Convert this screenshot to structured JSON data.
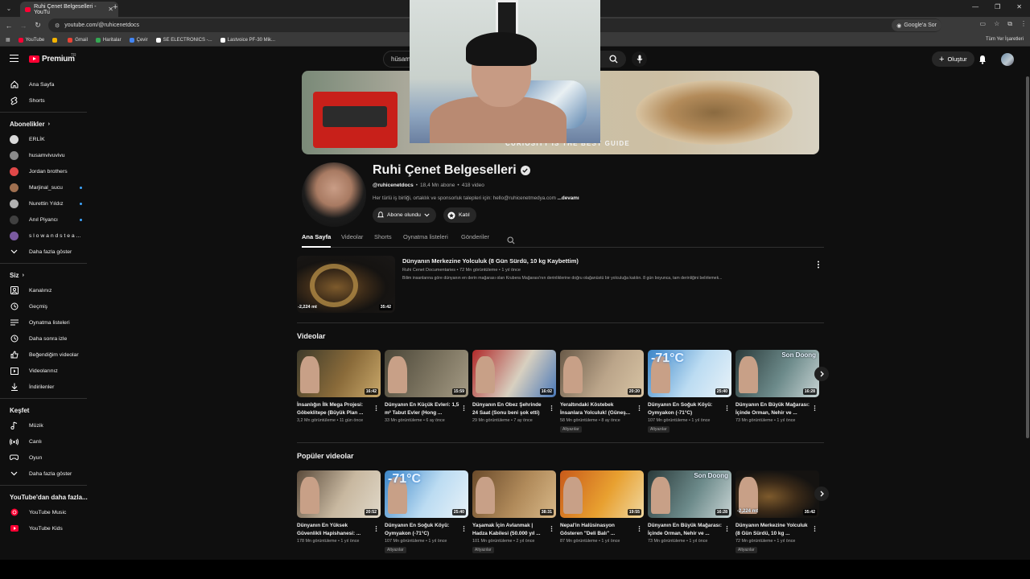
{
  "browser": {
    "tab_title": "Ruhi Çenet Belgeselleri - YouTu",
    "url": "youtube.com/@ruhicenetdocs",
    "google_lens": "Google'a Sor",
    "bookmarks": [
      {
        "label": "YouTube",
        "color": "#ff0033"
      },
      {
        "label": "",
        "color": "#f4b400"
      },
      {
        "label": "Gmail",
        "color": "#ea4335"
      },
      {
        "label": "Haritalar",
        "color": "#34a853"
      },
      {
        "label": "Çevir",
        "color": "#4285f4"
      },
      {
        "label": "SE ELECTRONICS -...",
        "color": "#ffffff"
      },
      {
        "label": "Lastvoice PF-30 Mik...",
        "color": "#ffffff"
      }
    ],
    "all_bookmarks": "Tüm Yer İşaretleri"
  },
  "header": {
    "logo": "Premium",
    "logo_sup": "TR",
    "search_value": "hüsam",
    "create_label": "Oluştur"
  },
  "sidebar": {
    "main": [
      {
        "label": "Ana Sayfa",
        "icon": "home-icon"
      },
      {
        "label": "Shorts",
        "icon": "shorts-icon"
      }
    ],
    "subs_heading": "Abonelikler",
    "subs": [
      {
        "label": "ERLİK",
        "color": "#d9d9d9",
        "dot": false
      },
      {
        "label": "husamvivuvivu",
        "color": "#8a8a8a",
        "dot": false
      },
      {
        "label": "Jordan brothers",
        "color": "#e04848",
        "dot": false
      },
      {
        "label": "Marjinal_sucu",
        "color": "#a07050",
        "dot": true
      },
      {
        "label": "Nurettin Yıldız",
        "color": "#b0b0b0",
        "dot": true
      },
      {
        "label": "Anıl Piyancı",
        "color": "#404040",
        "dot": true
      },
      {
        "label": "s l o w a n d s t e a ...",
        "color": "#7a5aa0",
        "dot": false
      }
    ],
    "subs_more": "Daha fazla göster",
    "you_heading": "Siz",
    "you": [
      {
        "label": "Kanalınız",
        "icon": "channel-icon"
      },
      {
        "label": "Geçmiş",
        "icon": "history-icon"
      },
      {
        "label": "Oynatma listeleri",
        "icon": "playlist-icon"
      },
      {
        "label": "Daha sonra izle",
        "icon": "clock-icon"
      },
      {
        "label": "Beğendiğim videolar",
        "icon": "like-icon"
      },
      {
        "label": "Videolarınız",
        "icon": "video-icon"
      },
      {
        "label": "İndirilenler",
        "icon": "download-icon"
      }
    ],
    "explore_heading": "Keşfet",
    "explore": [
      {
        "label": "Müzik",
        "icon": "music-icon"
      },
      {
        "label": "Canlı",
        "icon": "live-icon"
      },
      {
        "label": "Oyun",
        "icon": "gaming-icon"
      }
    ],
    "explore_more": "Daha fazla göster",
    "more_heading": "YouTube'dan daha fazla...",
    "more": [
      {
        "label": "YouTube Music"
      },
      {
        "label": "YouTube Kids"
      }
    ]
  },
  "channel": {
    "banner_tagline": "CURIOSITY IS THE BEST GUIDE",
    "name": "Ruhi Çenet Belgeselleri",
    "handle": "@ruhicenetdocs",
    "subscribers": "18,4 Mn abone",
    "video_count": "418 video",
    "description": "Her türlü iş birliği, ortaklık ve sponsorluk talepleri için: hello@ruhicenetmedya.com",
    "more": "...devamı",
    "subscribed_label": "Abone olundu",
    "join_label": "Katıl",
    "tabs": [
      "Ana Sayfa",
      "Videolar",
      "Shorts",
      "Oynatma listeleri",
      "Gönderiler"
    ]
  },
  "featured": {
    "thumb_label": "-2,224 mt",
    "duration": "35:42",
    "title": "Dünyanın Merkezine Yolculuk (8 Gün Sürdü, 10 kg Kaybettim)",
    "meta": "Ruhi Cenet Documentaries  •  72 Mn görüntüleme  •  1 yıl önce",
    "description": "Bilim insanlarına göre dünyanın en derin mağarası olan Krubera Mağarası'nın derinliklerine doğru olağanüstü bir yolculuğa katılın. 8 gün boyunca, tam derinliğini belirlemek..."
  },
  "shelf1": {
    "title": "Videolar",
    "cards": [
      {
        "title": "İnsanlığın İlk Mega Projesi: Göbeklitepe (Büyük Plan ...",
        "meta": "3,2 Mn görüntüleme  •  11 gün önce",
        "duration": "16:42",
        "badge": "",
        "tag": "",
        "bg": "linear-gradient(120deg,#3d3a2a,#8a6b3a 55%,#c9a86a)"
      },
      {
        "title": "Dünyanın En Küçük Evleri: 1,5 m² Tabut Evler (Hong ...",
        "meta": "33 Mn görüntüleme  •  6 ay önce",
        "duration": "15:59",
        "badge": "",
        "tag": "",
        "bg": "linear-gradient(120deg,#4a4638,#7c7460 55%,#a49a84)"
      },
      {
        "title": "Dünyanın En Obez Şehrinde 24 Saat (Sonu beni şok etti)",
        "meta": "29 Mn görüntüleme  •  7 ay önce",
        "duration": "16:02",
        "badge": "",
        "tag": "",
        "bg": "linear-gradient(120deg,#b02a2a,#d8d0c0 55%,#4a78b8)"
      },
      {
        "title": "Yeraltındaki Köstebek İnsanlara Yolculuk! (Güneş...",
        "meta": "58 Mn görüntüleme  •  8 ay önce",
        "duration": "20:20",
        "badge": "Altyazılar",
        "tag": "",
        "bg": "linear-gradient(120deg,#6a5a48,#bba58a 55%,#d8c4a4)"
      },
      {
        "title": "Dünyanın En Soğuk Köyü: Oymyakon (-71°C)",
        "meta": "107 Mn görüntüleme  •  1 yıl önce",
        "duration": "25:40",
        "badge": "Altyazılar",
        "tag": "-71°C",
        "bg": "linear-gradient(120deg,#3c86c8,#bcdcf2 55%,#e8f2f8)"
      },
      {
        "title": "Dünyanın En Büyük Mağarası: İçinde Orman, Nehir ve ...",
        "meta": "73 Mn görüntüleme  •  1 yıl önce",
        "duration": "16:28",
        "badge": "",
        "tag": "Son Doong",
        "bg": "linear-gradient(120deg,#2a3a3a,#6c8a8a 55%,#c8d4d4)"
      }
    ]
  },
  "shelf2": {
    "title": "Popüler videolar",
    "cards": [
      {
        "title": "Dünyanın En Yüksek Güvenlikli Hapishanesi: ...",
        "meta": "178 Mn görüntüleme  •  1 yıl önce",
        "duration": "20:52",
        "badge": "",
        "tag": "",
        "bg": "linear-gradient(120deg,#5a4a3a,#c8b8a0 55%,#e0d8c8)"
      },
      {
        "title": "Dünyanın En Soğuk Köyü: Oymyakon (-71°C)",
        "meta": "107 Mn görüntüleme  •  1 yıl önce",
        "duration": "25:40",
        "badge": "Altyazılar",
        "tag": "-71°C",
        "bg": "linear-gradient(120deg,#3c86c8,#bcdcf2 55%,#e8f2f8)"
      },
      {
        "title": "Yaşamak İçin Avlanmak | Hadza Kabilesi (50.000 yıl ...",
        "meta": "101 Mn görüntüleme  •  2 yıl önce",
        "duration": "38:31",
        "badge": "Altyazılar",
        "tag": "",
        "bg": "linear-gradient(120deg,#6a4a2a,#b08a5a 55%,#d8b888)"
      },
      {
        "title": "Nepal'in Halüsinasyon Gösteren \"Deli Balı\" ...",
        "meta": "87 Mn görüntüleme  •  1 yıl önce",
        "duration": "19:55",
        "badge": "",
        "tag": "",
        "bg": "linear-gradient(120deg,#c85a1a,#e8a030 55%,#f0d8a0)"
      },
      {
        "title": "Dünyanın En Büyük Mağarası: İçinde Orman, Nehir ve ...",
        "meta": "73 Mn görüntüleme  •  1 yıl önce",
        "duration": "16:28",
        "badge": "",
        "tag": "Son Doong",
        "bg": "linear-gradient(120deg,#2a3a3a,#6c8a8a 55%,#c8d4d4)"
      },
      {
        "title": "Dünyanın Merkezine Yolculuk (8 Gün Sürdü, 10 kg ...",
        "meta": "72 Mn görüntüleme  •  1 yıl önce",
        "duration": "35:42",
        "badge": "Altyazılar",
        "tag": "-2,224 mt",
        "bg": "radial-gradient(ellipse at 40% 55%,#7d5a2c 0%,#3b2a18 40%,#151311 70%)"
      }
    ]
  }
}
